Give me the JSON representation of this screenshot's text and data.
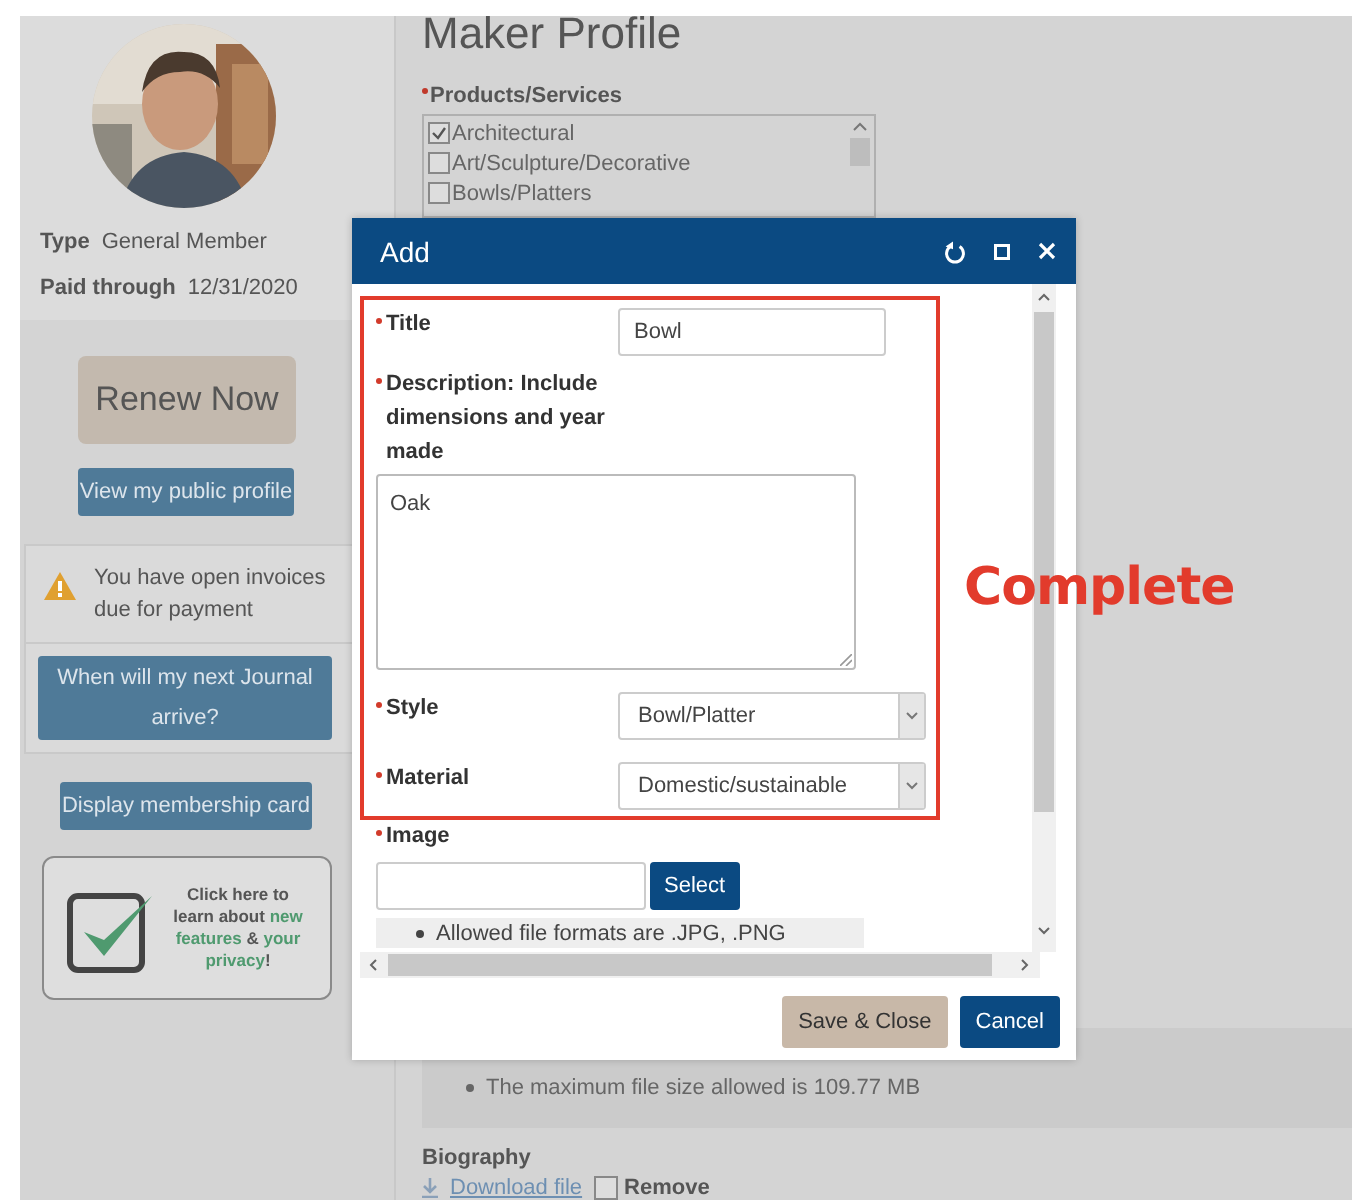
{
  "sidebar": {
    "member_info": [
      {
        "label": "Type",
        "value": "General Member"
      },
      {
        "label": "Paid through",
        "value": "12/31/2020"
      }
    ],
    "renew_button": "Renew Now",
    "profile_button": "View my public profile",
    "alert": {
      "text": "You have open invoices due for payment",
      "button": "When will my next Journal arrive?"
    },
    "card_button": "Display membership card",
    "promo": {
      "text": "Click here to learn about",
      "link_1": "new features",
      "joiner": "&",
      "link_2": "your privacy",
      "end": "!"
    }
  },
  "main": {
    "heading": "Maker Profile",
    "products": {
      "label": "Products/Services",
      "required": true,
      "options": [
        {
          "label": "Architectural",
          "checked": true
        },
        {
          "label": "Art/Sculpture/Decorative",
          "checked": false
        },
        {
          "label": "Bowls/Platters",
          "checked": false
        }
      ]
    },
    "notes": [
      "The maximum file size allowed is 109.77 MB"
    ],
    "biography": {
      "label": "Biography",
      "download": "Download file",
      "remove": {
        "label": "Remove",
        "checked": false
      }
    }
  },
  "dialog": {
    "title": "Add",
    "fields": [
      {
        "kind": "text",
        "label": "Title",
        "required": true,
        "value": "Bowl"
      },
      {
        "kind": "textarea",
        "label": "Description: Include dimensions and year made",
        "required": true,
        "value": "Oak"
      },
      {
        "kind": "select",
        "label": "Style",
        "required": true,
        "value": "Bowl/Platter"
      },
      {
        "kind": "select",
        "label": "Material",
        "required": true,
        "value": "Domestic/sustainable"
      },
      {
        "kind": "file",
        "label": "Image",
        "required": true,
        "button": "Select",
        "notes": [
          "Allowed file formats are .JPG, .PNG"
        ]
      }
    ],
    "buttons": [
      {
        "label": "Save & Close",
        "kind": "secondary"
      },
      {
        "label": "Cancel",
        "kind": "primary"
      }
    ]
  },
  "annotation": {
    "text": "Complete"
  }
}
